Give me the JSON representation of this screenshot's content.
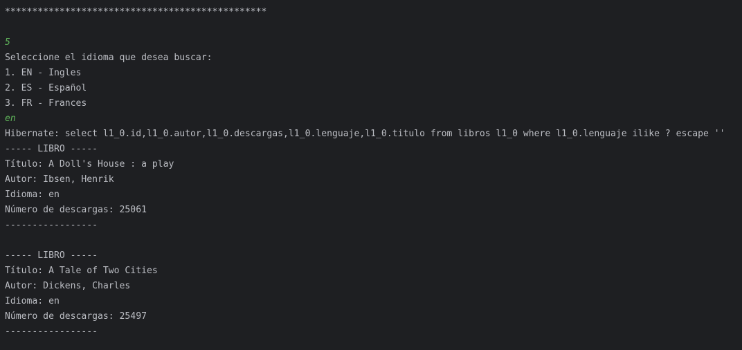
{
  "console": {
    "colors": {
      "background": "#1e1f22",
      "output_text": "#bcbec4",
      "user_input": "#5fb35a"
    },
    "lines": [
      {
        "text": "************************************************",
        "kind": "output"
      },
      {
        "text": "",
        "kind": "output"
      },
      {
        "text": "5",
        "kind": "input"
      },
      {
        "text": "Seleccione el idioma que desea buscar:",
        "kind": "output"
      },
      {
        "text": "1. EN - Ingles",
        "kind": "output"
      },
      {
        "text": "2. ES - Español",
        "kind": "output"
      },
      {
        "text": "3. FR - Frances",
        "kind": "output"
      },
      {
        "text": "en",
        "kind": "input"
      },
      {
        "text": "Hibernate: select l1_0.id,l1_0.autor,l1_0.descargas,l1_0.lenguaje,l1_0.titulo from libros l1_0 where l1_0.lenguaje ilike ? escape ''",
        "kind": "output"
      },
      {
        "text": "----- LIBRO -----",
        "kind": "output"
      },
      {
        "text": "Título: A Doll's House : a play",
        "kind": "output"
      },
      {
        "text": "Autor: Ibsen, Henrik",
        "kind": "output"
      },
      {
        "text": "Idioma: en",
        "kind": "output"
      },
      {
        "text": "Número de descargas: 25061",
        "kind": "output"
      },
      {
        "text": "-----------------",
        "kind": "output"
      },
      {
        "text": "",
        "kind": "output"
      },
      {
        "text": "----- LIBRO -----",
        "kind": "output"
      },
      {
        "text": "Título: A Tale of Two Cities",
        "kind": "output"
      },
      {
        "text": "Autor: Dickens, Charles",
        "kind": "output"
      },
      {
        "text": "Idioma: en",
        "kind": "output"
      },
      {
        "text": "Número de descargas: 25497",
        "kind": "output"
      },
      {
        "text": "-----------------",
        "kind": "output"
      }
    ]
  }
}
